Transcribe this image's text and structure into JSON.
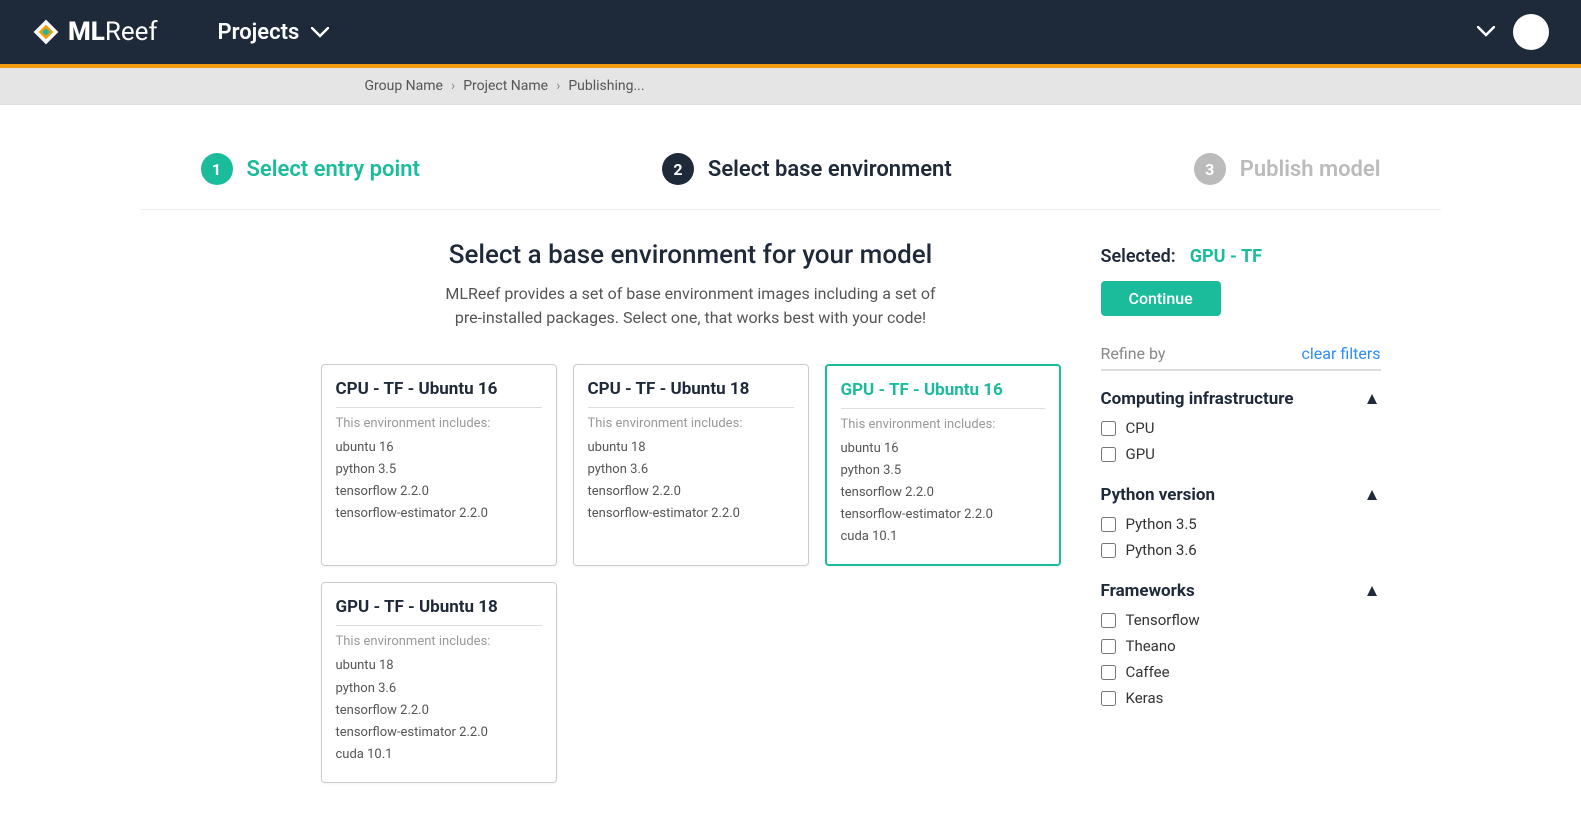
{
  "header": {
    "brand_bold": "ML",
    "brand_light": "Reef",
    "nav_projects": "Projects"
  },
  "breadcrumb": {
    "group": "Group Name",
    "project": "Project Name",
    "current": "Publishing..."
  },
  "stepper": {
    "step1": {
      "num": "1",
      "label": "Select entry point"
    },
    "step2": {
      "num": "2",
      "label": "Select base environment"
    },
    "step3": {
      "num": "3",
      "label": "Publish model"
    }
  },
  "page": {
    "title": "Select a base environment for your model",
    "sub1": "MLReef provides a set of base environment images including a set of",
    "sub2": "pre-installed packages. Select one, that works best with your code!",
    "includes_label": "This environment includes:"
  },
  "cards": [
    {
      "title": "CPU - TF - Ubuntu 16",
      "selected": false,
      "items": [
        "ubuntu 16",
        "python 3.5",
        "tensorflow 2.2.0",
        "tensorflow-estimator 2.2.0"
      ]
    },
    {
      "title": "CPU - TF - Ubuntu 18",
      "selected": false,
      "items": [
        "ubuntu 18",
        "python 3.6",
        "tensorflow 2.2.0",
        "tensorflow-estimator 2.2.0"
      ]
    },
    {
      "title": "GPU - TF - Ubuntu 16",
      "selected": true,
      "items": [
        "ubuntu 16",
        "python 3.5",
        "tensorflow 2.2.0",
        "tensorflow-estimator 2.2.0",
        "cuda 10.1"
      ]
    },
    {
      "title": "GPU - TF - Ubuntu 18",
      "selected": false,
      "items": [
        "ubuntu 18",
        "python 3.6",
        "tensorflow 2.2.0",
        "tensorflow-estimator 2.2.0",
        "cuda 10.1"
      ]
    }
  ],
  "sidebar": {
    "selected_label": "Selected:",
    "selected_value": "GPU - TF",
    "continue": "Continue",
    "refine_by": "Refine by",
    "clear_filters": "clear filters",
    "groups": [
      {
        "title": "Computing infrastructure",
        "options": [
          "CPU",
          "GPU"
        ]
      },
      {
        "title": "Python version",
        "options": [
          "Python 3.5",
          "Python 3.6"
        ]
      },
      {
        "title": "Frameworks",
        "options": [
          "Tensorflow",
          "Theano",
          "Caffee",
          "Keras"
        ]
      }
    ]
  }
}
